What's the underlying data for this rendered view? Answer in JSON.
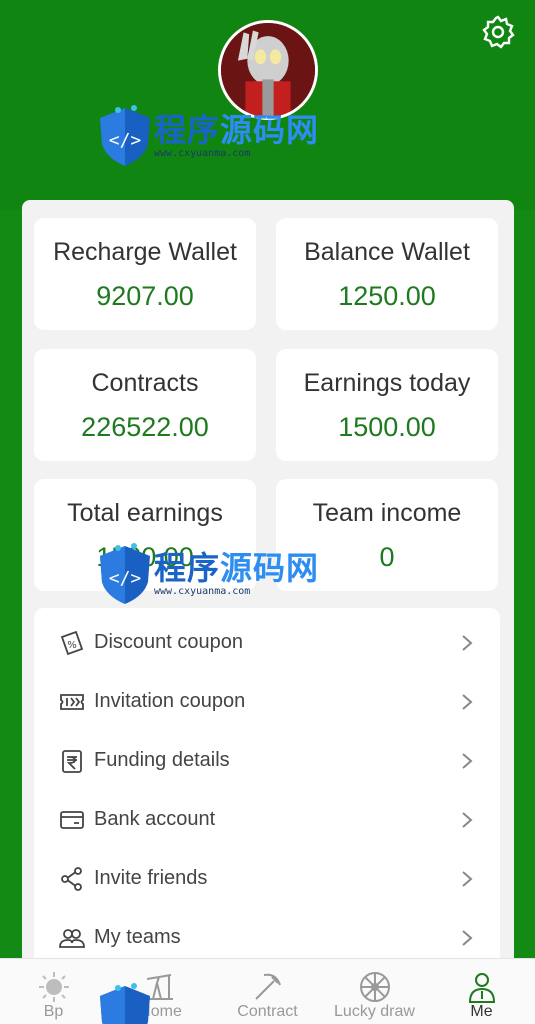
{
  "header": {
    "avatar_name": "user-avatar",
    "settings_icon": "gear-icon"
  },
  "watermark": {
    "brand_part1": "程序",
    "brand_part2": "源码网",
    "url": "www.cxyuanma.com"
  },
  "stats": [
    {
      "label": "Recharge Wallet",
      "value": "9207.00"
    },
    {
      "label": "Balance Wallet",
      "value": "1250.00"
    },
    {
      "label": "Contracts",
      "value": "226522.00"
    },
    {
      "label": "Earnings today",
      "value": "1500.00"
    },
    {
      "label": "Total earnings",
      "value": "1500.00"
    },
    {
      "label": "Team income",
      "value": "0"
    }
  ],
  "menu": [
    {
      "label": "Discount coupon",
      "icon": "coupon-percent-icon"
    },
    {
      "label": "Invitation coupon",
      "icon": "ticket-icon"
    },
    {
      "label": "Funding details",
      "icon": "rupee-document-icon"
    },
    {
      "label": "Bank account",
      "icon": "bank-card-icon"
    },
    {
      "label": "Invite friends",
      "icon": "share-icon"
    },
    {
      "label": "My teams",
      "icon": "team-icon"
    }
  ],
  "tabs": [
    {
      "label": "Bp",
      "icon": "sun-icon"
    },
    {
      "label": "Home",
      "icon": "oil-pump-icon"
    },
    {
      "label": "Contract",
      "icon": "pickaxe-icon"
    },
    {
      "label": "Lucky draw",
      "icon": "wheel-icon"
    },
    {
      "label": "Me",
      "icon": "person-icon"
    }
  ],
  "colors": {
    "brand_green": "#118511",
    "value_green": "#1f7a1f",
    "panel_bg": "#f2f2f2"
  }
}
